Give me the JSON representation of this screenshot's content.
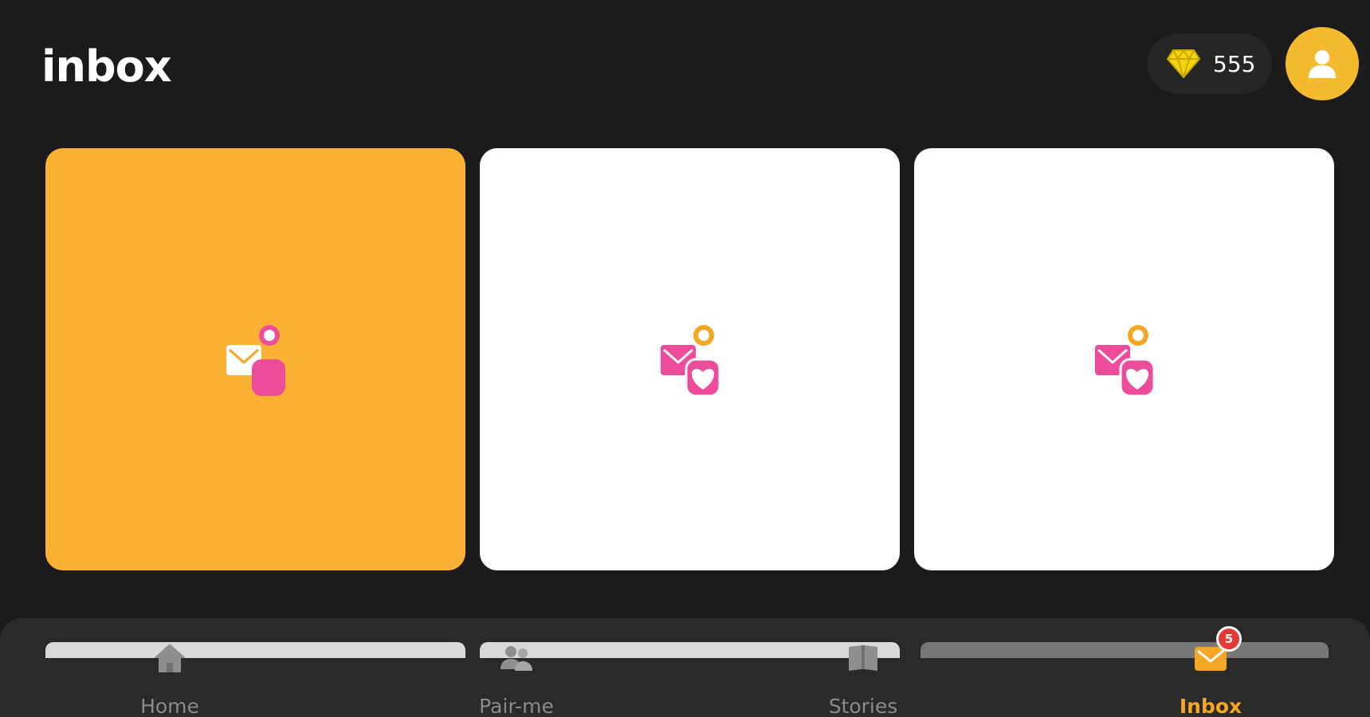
{
  "header": {
    "title": "inbox",
    "gem_count": "555"
  },
  "cards": [
    {
      "icon": "mail-dot-icon",
      "state": "selected"
    },
    {
      "icon": "mail-heart-icon",
      "state": "default"
    },
    {
      "icon": "mail-heart-icon",
      "state": "default"
    }
  ],
  "nav": {
    "items": [
      {
        "label": "Home",
        "icon": "home-icon"
      },
      {
        "label": "Pair-me",
        "icon": "people-icon"
      },
      {
        "label": "Stories",
        "icon": "book-icon"
      },
      {
        "label": "Inbox",
        "icon": "mail-icon",
        "active": true
      }
    ],
    "inbox_badge": "5"
  },
  "colors": {
    "background": "#1b1b1b",
    "accent_orange": "#fbb133",
    "avatar_yellow": "#f5bb2f",
    "pink": "#ec4c9a",
    "gem_yellow": "#f6d40a",
    "active_nav": "#f5a623",
    "badge_red": "#e53935"
  }
}
